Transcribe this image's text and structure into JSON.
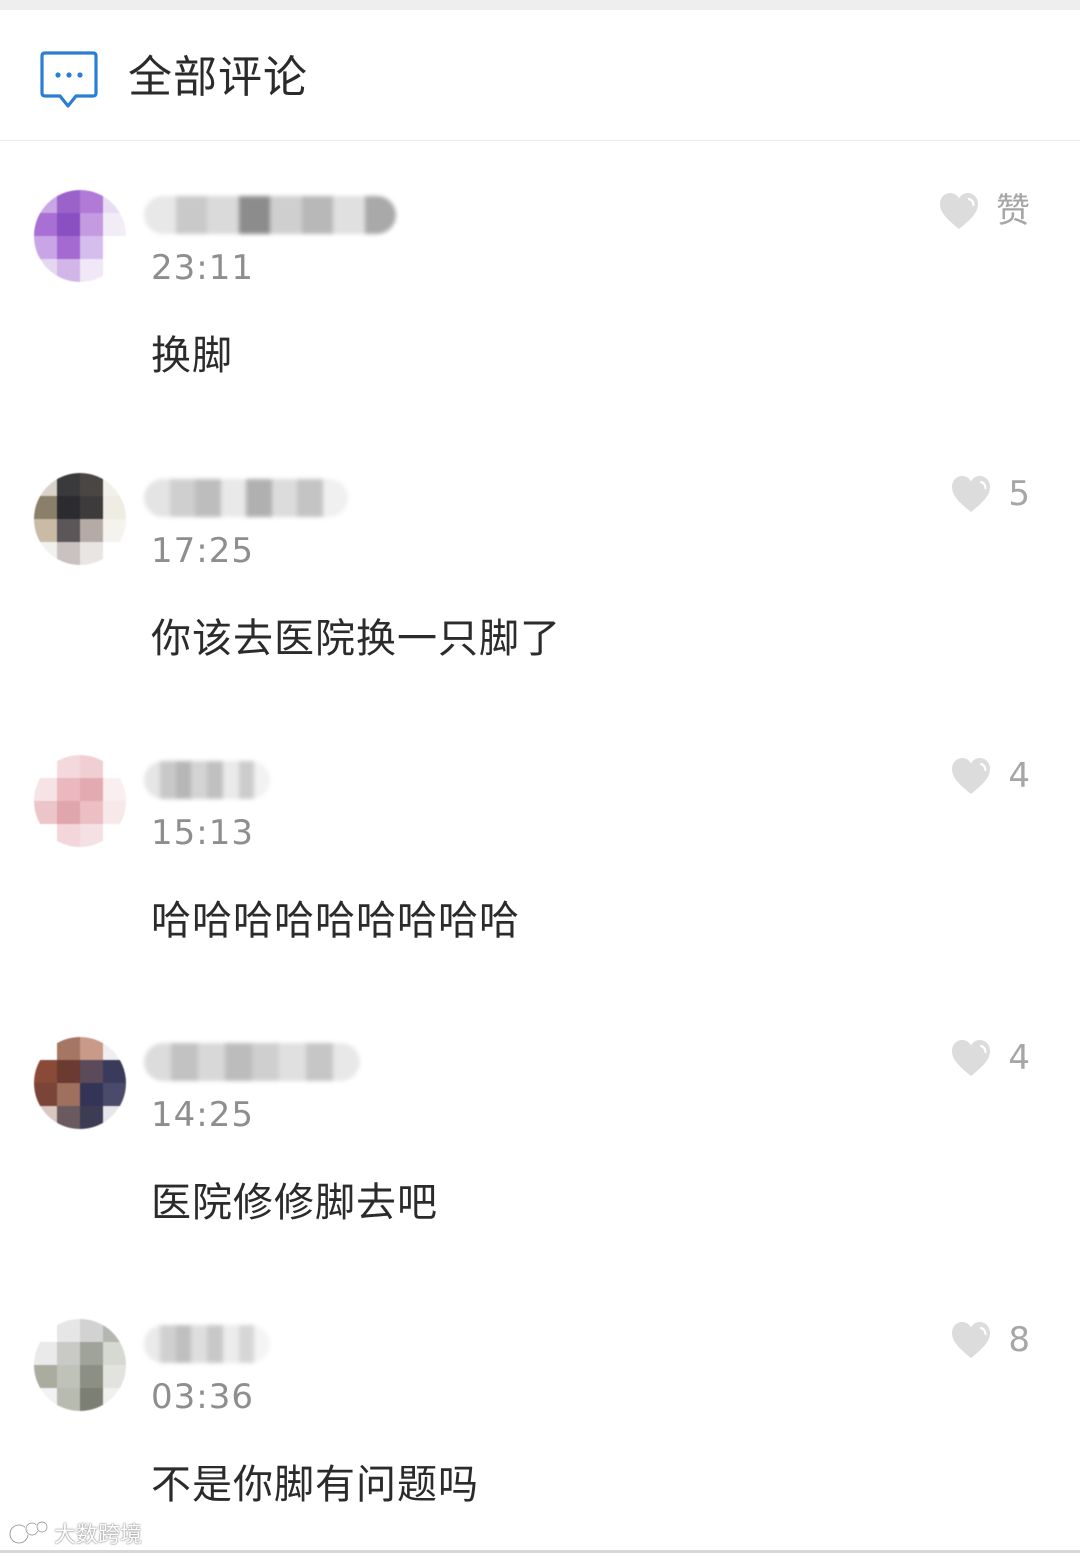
{
  "header": {
    "title": "全部评论",
    "icon": "comment-bubble-icon",
    "accent": "#2a7fd4"
  },
  "comments": [
    {
      "time": "23:11",
      "text": "换脚",
      "likes": "赞",
      "avatar_colors": [
        "#c9a6e6",
        "#9b63c9",
        "#b07ad6",
        "#e8dcf2",
        "#a86fd4",
        "#8a4fc0",
        "#c49ae0",
        "#f2ecf7",
        "#caa5e6",
        "#a46ad2",
        "#d5bdee",
        "#ffffff",
        "#e6d7f1",
        "#d2b6ea",
        "#f0e8f6",
        "#ffffff"
      ]
    },
    {
      "time": "17:25",
      "text": "你该去医院换一只脚了",
      "likes": "5",
      "avatar_colors": [
        "#d8d2c8",
        "#3a3a3c",
        "#4a4644",
        "#f2f0ea",
        "#8a8069",
        "#2c2c30",
        "#3d3b3c",
        "#efece4",
        "#c9bba6",
        "#5b5658",
        "#b6aaa6",
        "#f5f3ee",
        "#f3f1ec",
        "#c9c2c0",
        "#e9e5e2",
        "#ffffff"
      ]
    },
    {
      "time": "15:13",
      "text": "哈哈哈哈哈哈哈哈哈",
      "likes": "4",
      "avatar_colors": [
        "#ffffff",
        "#f3d9dc",
        "#f0cfd3",
        "#ffffff",
        "#f6e3e5",
        "#e9b9bf",
        "#e3aab1",
        "#f9eef0",
        "#ecc5c9",
        "#e0a6ad",
        "#ebbfc4",
        "#f7e8ea",
        "#ffffff",
        "#f2d6d9",
        "#f5e1e3",
        "#ffffff"
      ]
    },
    {
      "time": "14:25",
      "text": "医院修修脚去吧",
      "likes": "4",
      "avatar_colors": [
        "#ffffff",
        "#a57664",
        "#c99a88",
        "#f0eef0",
        "#8a4a38",
        "#6b3a30",
        "#5a4a5a",
        "#3a3a5a",
        "#7a4438",
        "#a0705e",
        "#343456",
        "#4a4a6a",
        "#d8c8c0",
        "#6a5a5e",
        "#3c3c54",
        "#e8e6ea"
      ]
    },
    {
      "time": "03:36",
      "text": "不是你脚有问题吗",
      "likes": "8",
      "avatar_colors": [
        "#ffffff",
        "#e6e6e6",
        "#d2d2d2",
        "#b4b6b0",
        "#eaeaea",
        "#c9c9c6",
        "#9fa39a",
        "#d6d8d2",
        "#a9ac9f",
        "#bfc2b8",
        "#8c9084",
        "#e2e3de",
        "#f2f2f2",
        "#b8bbb0",
        "#7c8074",
        "#f0f0ee"
      ]
    }
  ],
  "watermark": {
    "text": "大数跨境"
  },
  "colors": {
    "heart": "#dcdcdc",
    "time": "#8e8e8e",
    "text": "#2b2b2b"
  }
}
